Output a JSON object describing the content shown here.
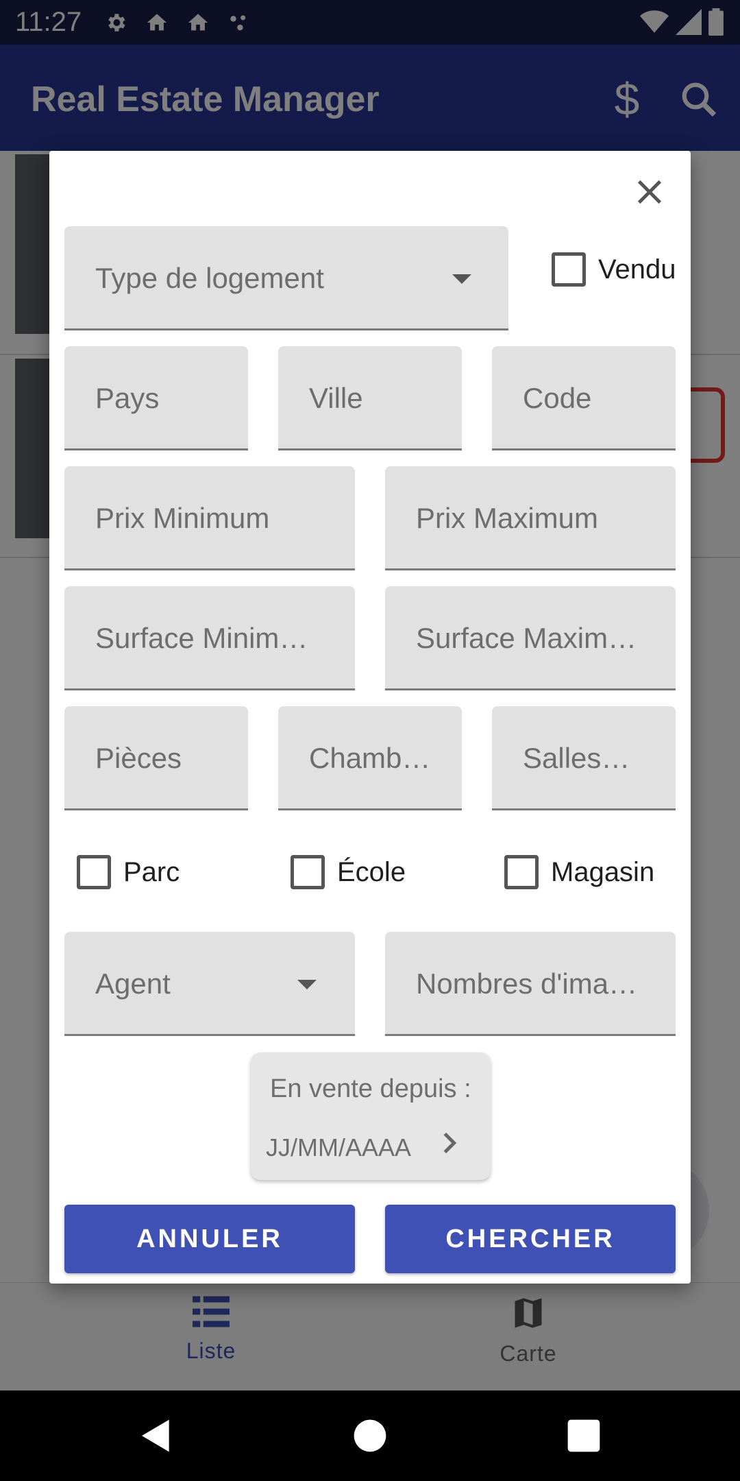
{
  "status_bar": {
    "time": "11:27",
    "icons_left": [
      "settings-icon",
      "home-icon",
      "home-icon",
      "dots-icon"
    ],
    "icons_right": [
      "wifi-icon",
      "signal-icon",
      "battery-icon"
    ]
  },
  "app_bar": {
    "title": "Real Estate Manager",
    "actions": [
      "dollar-icon",
      "search-icon"
    ],
    "color": "#283593"
  },
  "bottom_nav": {
    "items": [
      {
        "label": "Liste",
        "icon": "list-icon",
        "active": true
      },
      {
        "label": "Carte",
        "icon": "map-icon",
        "active": false
      }
    ],
    "active_color": "#3f51b5"
  },
  "dialog": {
    "close_icon": "close-icon",
    "type_field": {
      "placeholder": "Type de logement"
    },
    "sold_checkbox": {
      "label": "Vendu",
      "checked": false
    },
    "location_fields": [
      {
        "placeholder": "Pays"
      },
      {
        "placeholder": "Ville"
      },
      {
        "placeholder": "Code"
      }
    ],
    "price_fields": [
      {
        "placeholder": "Prix Minimum"
      },
      {
        "placeholder": "Prix Maximum"
      }
    ],
    "surface_fields": [
      {
        "placeholder": "Surface Minim…"
      },
      {
        "placeholder": "Surface Maxim…"
      }
    ],
    "room_fields": [
      {
        "placeholder": "Pièces"
      },
      {
        "placeholder": "Chamb…"
      },
      {
        "placeholder": "Salles…"
      }
    ],
    "poi_checkboxes": [
      {
        "label": "Parc",
        "checked": false
      },
      {
        "label": "École",
        "checked": false
      },
      {
        "label": "Magasin",
        "checked": false
      }
    ],
    "agent_field": {
      "placeholder": "Agent"
    },
    "images_field": {
      "placeholder": "Nombres d'ima…"
    },
    "date": {
      "title": "En vente depuis :",
      "value": "JJ/MM/AAAA"
    },
    "buttons": {
      "cancel": "ANNULER",
      "search": "CHERCHER"
    },
    "button_color": "#3f51b5"
  }
}
